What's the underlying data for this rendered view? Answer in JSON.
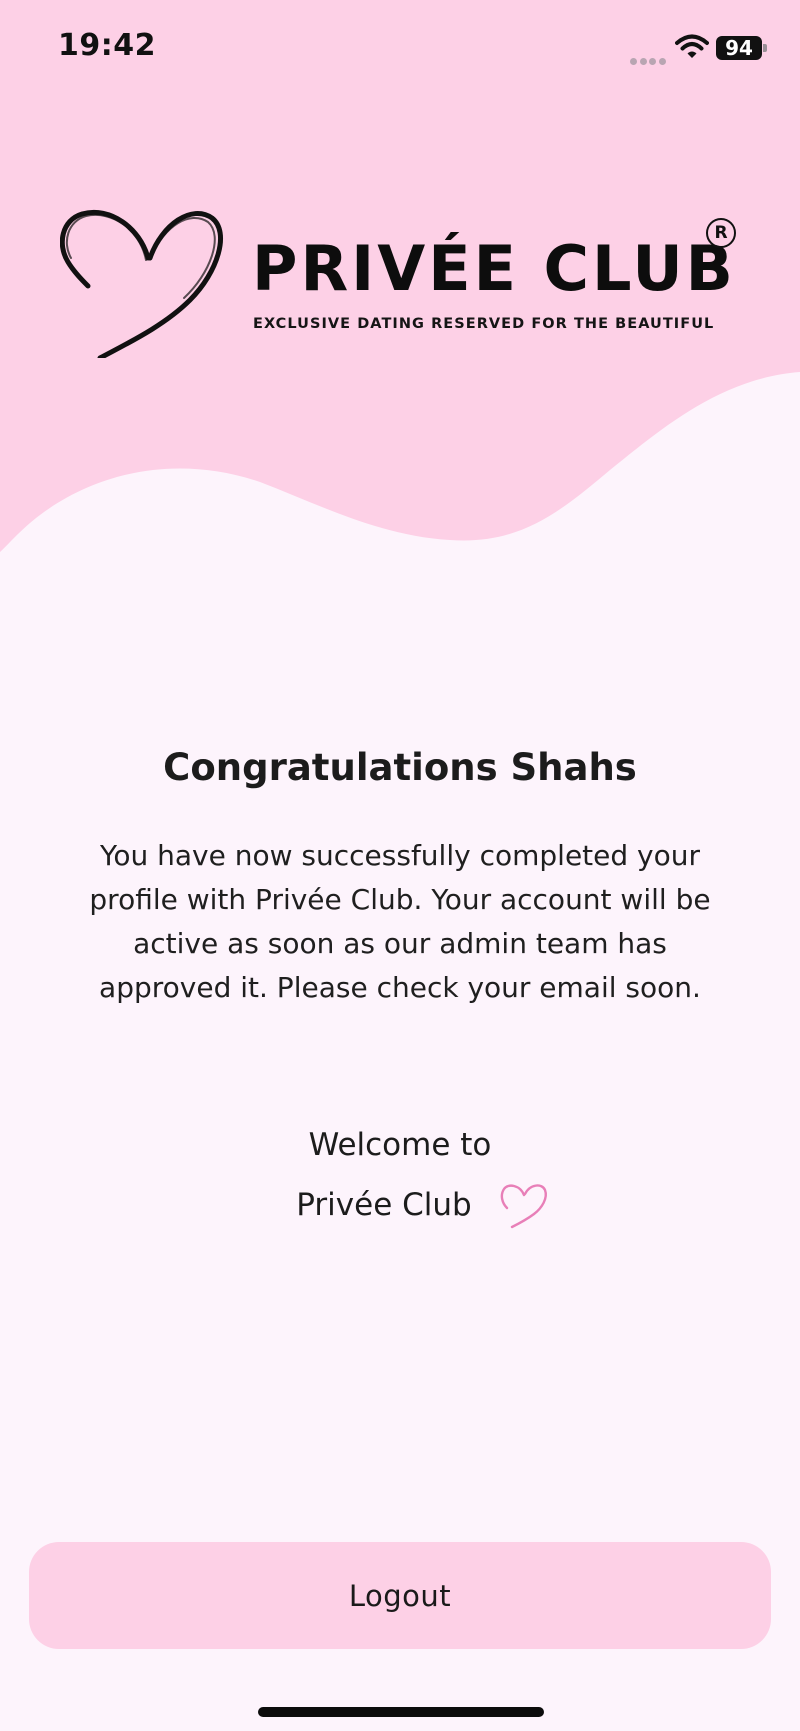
{
  "status_bar": {
    "time": "19:42",
    "battery": "94"
  },
  "logo": {
    "brand_name": "PRIVÉE CLUB",
    "registered_mark": "R",
    "tagline": "EXCLUSIVE DATING RESERVED FOR THE BEAUTIFUL"
  },
  "content": {
    "title": "Congratulations Shahs",
    "message": "You have now successfully completed your profile with Privée Club. Your account will be active as soon as our admin team has approved it. Please check your email soon.",
    "welcome_line1": "Welcome to",
    "welcome_line2": "Privée Club"
  },
  "actions": {
    "logout_label": "Logout"
  },
  "colors": {
    "header_pink": "#fdd0e6",
    "background": "#fdf4fc",
    "button_pink": "#fdd0e6",
    "heart_accent": "#e87fb8"
  }
}
